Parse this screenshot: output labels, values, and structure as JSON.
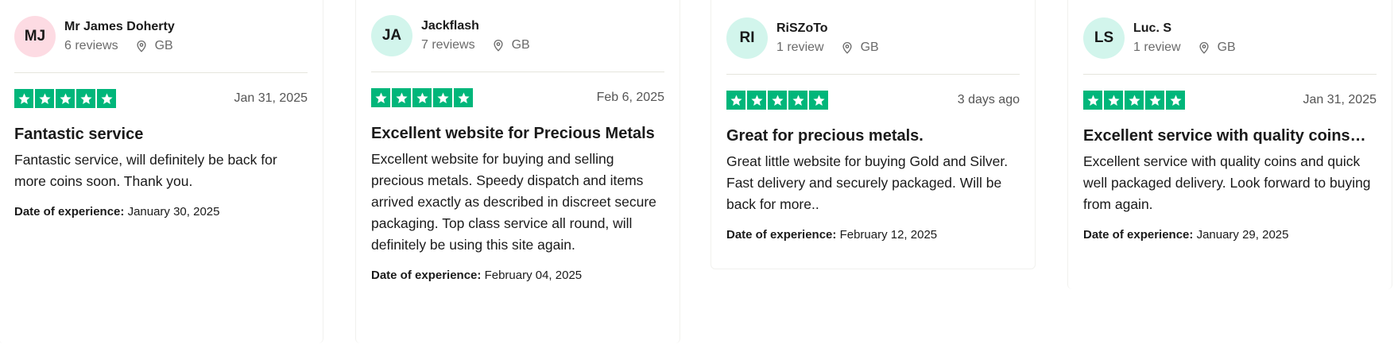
{
  "reviews": [
    {
      "initials": "MJ",
      "avatar_color": "#fddbe3",
      "name": "Mr James Doherty",
      "review_count": "6 reviews",
      "country": "GB",
      "stars": 5,
      "date": "Jan 31, 2025",
      "title": "Fantastic service",
      "body": "Fantastic service, will definitely be back for more coins soon. Thank you.",
      "experience_label": "Date of experience:",
      "experience_date": "January 30, 2025"
    },
    {
      "initials": "JA",
      "avatar_color": "#d2f5ec",
      "name": "Jackflash",
      "review_count": "7 reviews",
      "country": "GB",
      "stars": 5,
      "date": "Feb 6, 2025",
      "title": "Excellent website for Precious Metals",
      "body": "Excellent website for buying and selling precious metals. Speedy dispatch and items arrived exactly as described in discreet secure packaging. Top class service all round, will definitely be using this site again.",
      "experience_label": "Date of experience:",
      "experience_date": "February 04, 2025"
    },
    {
      "initials": "RI",
      "avatar_color": "#d2f5ec",
      "name": "RiSZoTo",
      "review_count": "1 review",
      "country": "GB",
      "stars": 5,
      "date": "3 days ago",
      "title": "Great for precious metals.",
      "body": "Great little website for buying Gold and Silver. Fast delivery and securely packaged. Will be back for more..",
      "experience_label": "Date of experience:",
      "experience_date": "February 12, 2025"
    },
    {
      "initials": "LS",
      "avatar_color": "#d2f5ec",
      "name": "Luc. S",
      "review_count": "1 review",
      "country": "GB",
      "stars": 5,
      "date": "Jan 31, 2025",
      "title": "Excellent service with quality coins…",
      "body": "Excellent service with quality coins and quick well packaged delivery. Look forward to buying from again.",
      "experience_label": "Date of experience:",
      "experience_date": "January 29, 2025"
    }
  ],
  "colors": {
    "star_green": "#00b67a",
    "muted_text": "#6b6b6b"
  },
  "icons": {
    "location": "location-pin-icon",
    "star": "star-icon"
  }
}
